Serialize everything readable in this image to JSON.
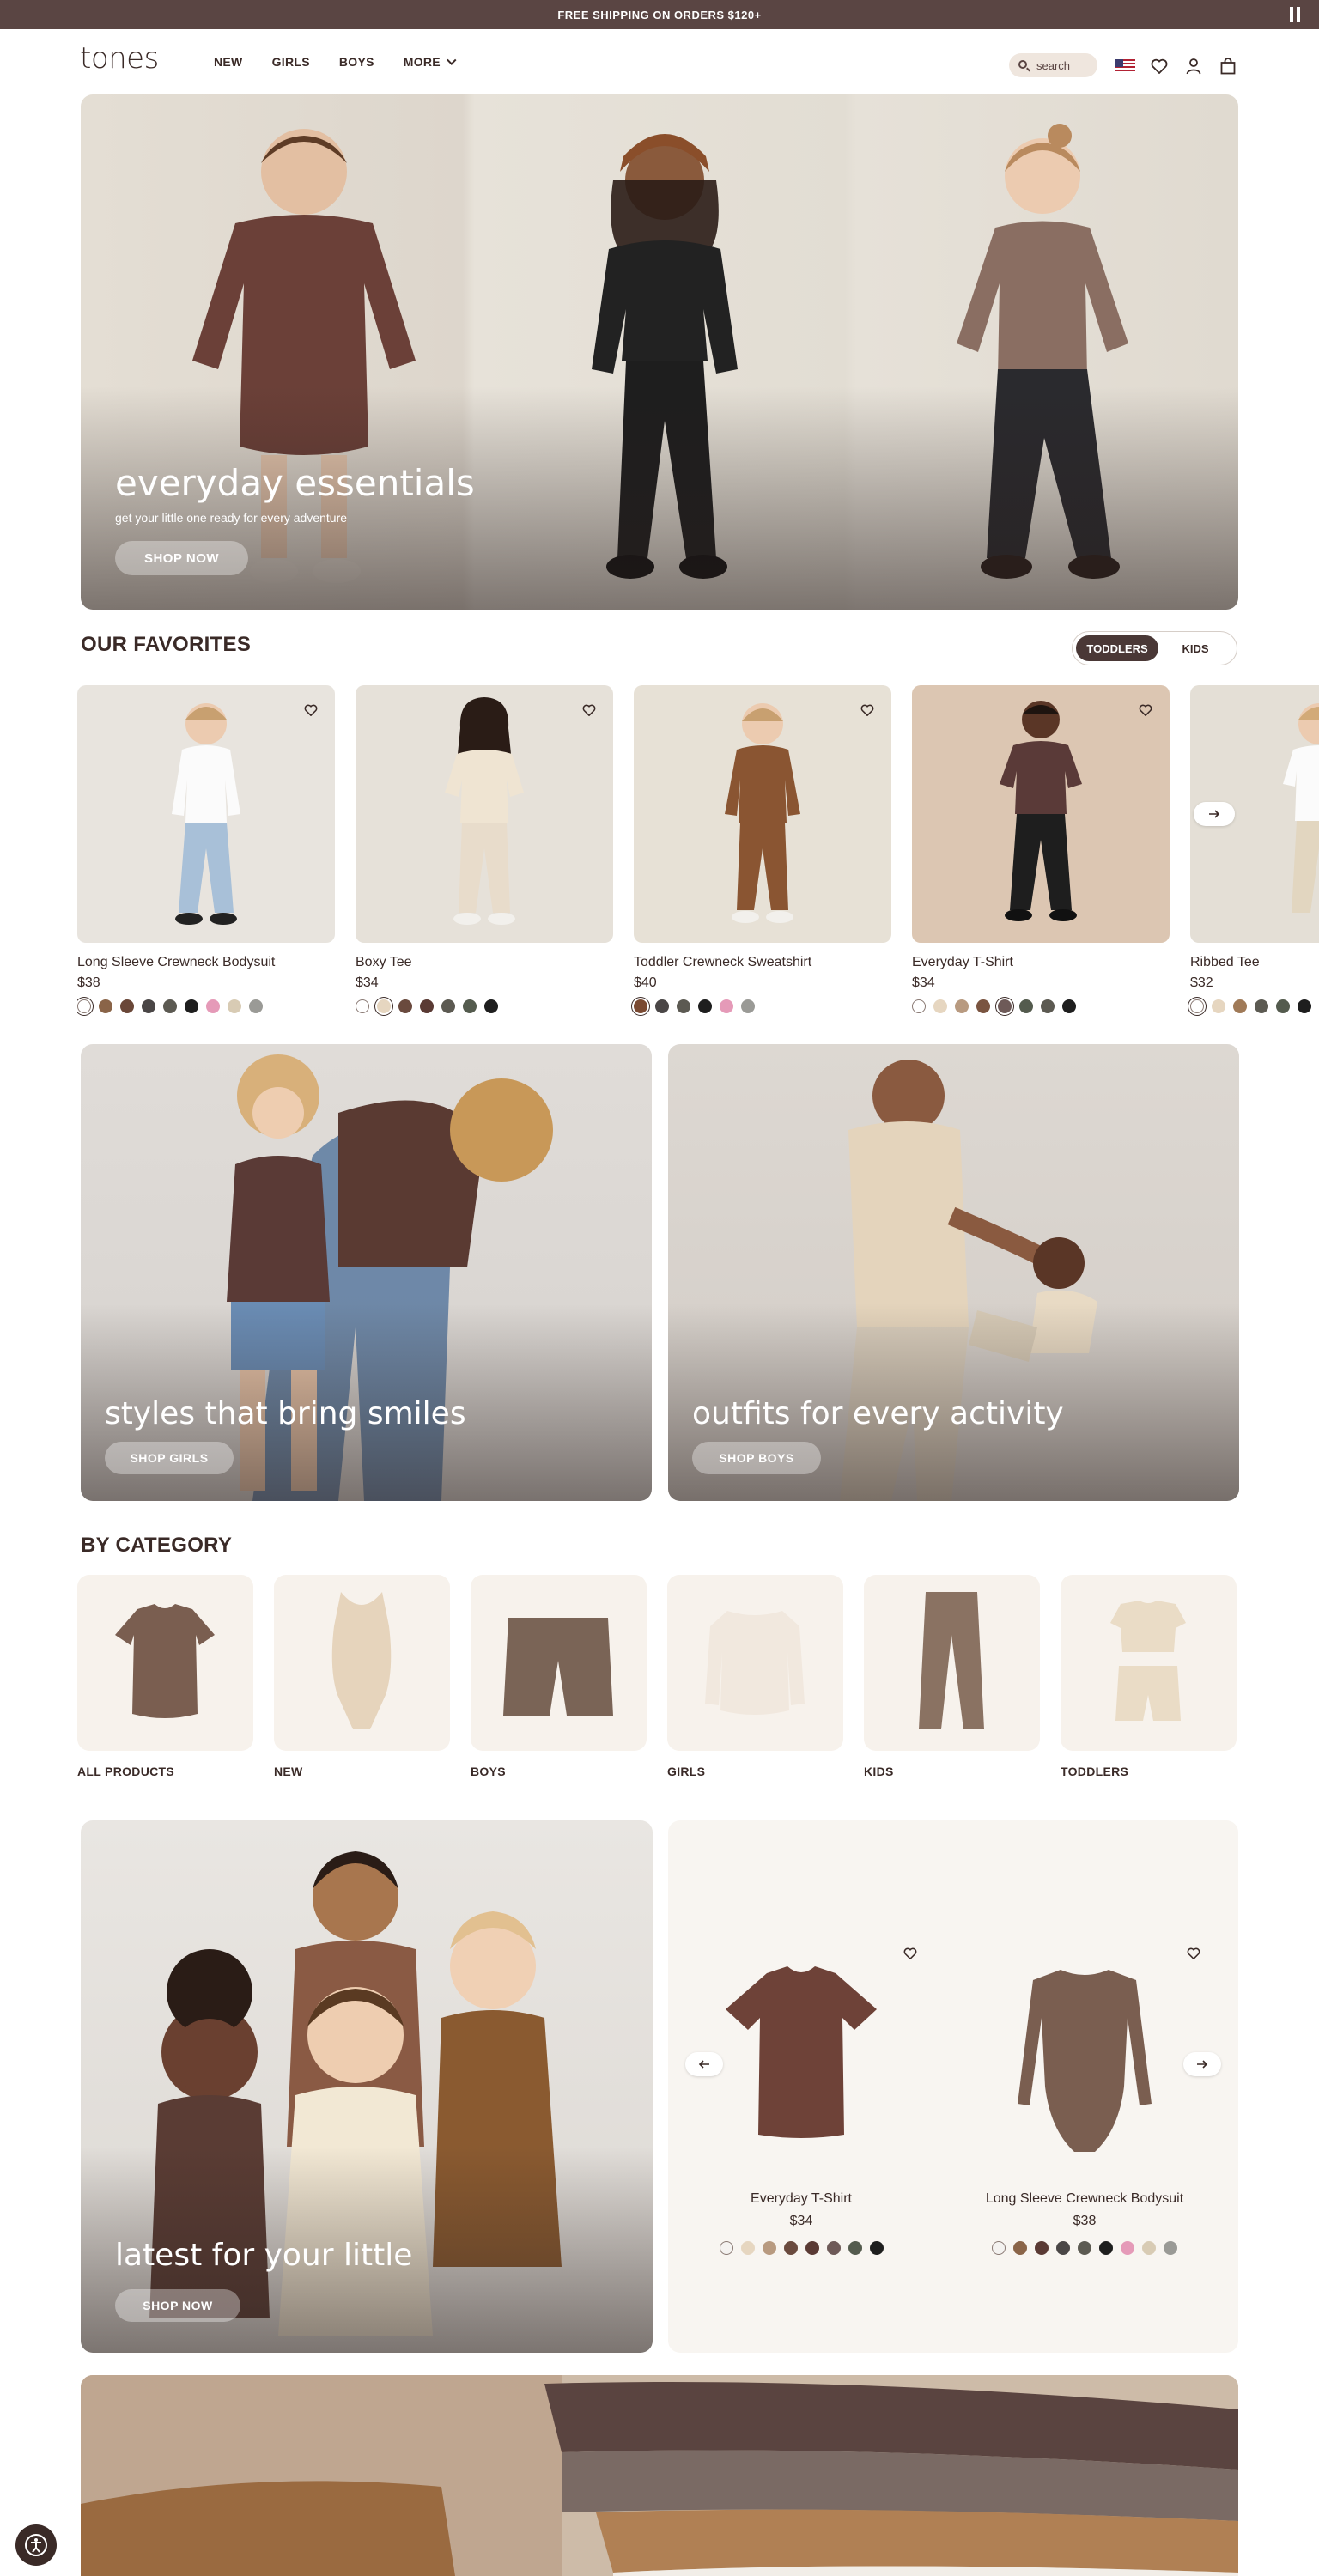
{
  "announcement": {
    "text": "FREE SHIPPING ON ORDERS $120+"
  },
  "header": {
    "logo": "tones",
    "nav": [
      "NEW",
      "GIRLS",
      "BOYS",
      "MORE"
    ],
    "search_label": "search"
  },
  "hero": {
    "title": "everyday essentials",
    "subtitle": "get your little one ready for every adventure",
    "cta": "SHOP NOW"
  },
  "favorites": {
    "title": "OUR FAVORITES",
    "toggle": [
      "TODDLERS",
      "KIDS"
    ],
    "products": [
      {
        "name": "Long Sleeve Crewneck Bodysuit",
        "price": "$38",
        "swatches": [
          "#ffffff",
          "#8a6448",
          "#6a4738",
          "#4a4646",
          "#5c5a52",
          "#1e1e1e",
          "#e59ab8",
          "#d8cbb4",
          "#9a9a96"
        ]
      },
      {
        "name": "Boxy Tee",
        "price": "$34",
        "swatches": [
          "#ffffff",
          "#e6d6c0",
          "#6a4a3e",
          "#5a3a34",
          "#5c5a52",
          "#545b4e",
          "#1e1e1e"
        ]
      },
      {
        "name": "Toddler Crewneck Sweatshirt",
        "price": "$40",
        "swatches": [
          "#7a4a32",
          "#4a4646",
          "#5c5a52",
          "#1e1e1e",
          "#e59ab8",
          "#9a9a96"
        ]
      },
      {
        "name": "Everyday T-Shirt",
        "price": "$34",
        "swatches": [
          "#ffffff",
          "#e6d6c0",
          "#b89a80",
          "#7a5440",
          "#6e5a58",
          "#545b4e",
          "#5c5a52",
          "#1e1e1e"
        ]
      },
      {
        "name": "Ribbed Tee",
        "price": "$32",
        "swatches": [
          "#ffffff",
          "#e6d6c0",
          "#a07a58",
          "#5c5a52",
          "#545b4e",
          "#1e1e1e"
        ]
      }
    ]
  },
  "tiles": [
    {
      "title": "styles that bring smiles",
      "cta": "SHOP GIRLS"
    },
    {
      "title": "outfits for every activity",
      "cta": "SHOP BOYS"
    }
  ],
  "category": {
    "title": "BY CATEGORY",
    "items": [
      "ALL PRODUCTS",
      "NEW",
      "BOYS",
      "GIRLS",
      "KIDS",
      "TODDLERS"
    ]
  },
  "latest": {
    "title": "latest for your little",
    "cta": "SHOP NOW",
    "products": [
      {
        "name": "Everyday T-Shirt",
        "price": "$34",
        "swatches": [
          "#f4f2f0",
          "#e6d6c0",
          "#b89a80",
          "#6a4a3e",
          "#5a3a34",
          "#6e5a58",
          "#545b4e",
          "#1e1e1e"
        ]
      },
      {
        "name": "Long Sleeve Crewneck Bodysuit",
        "price": "$38",
        "swatches": [
          "#f4f2f0",
          "#8a6448",
          "#5a3a34",
          "#4a4646",
          "#5c5a52",
          "#1e1e1e",
          "#e59ab8",
          "#d8cbb4",
          "#9a9a96"
        ]
      }
    ]
  },
  "colors": {
    "accent": "#5a4543",
    "text": "#3a2a27",
    "soft": "#f7f2ec"
  }
}
